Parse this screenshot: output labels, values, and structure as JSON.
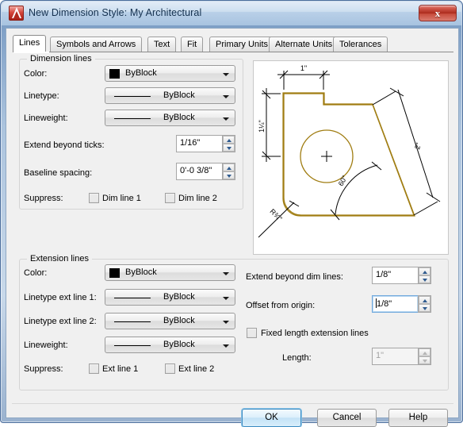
{
  "window": {
    "title": "New Dimension Style: My Architectural",
    "icon": "autocad-logo-icon",
    "close_label": "x"
  },
  "tabs": [
    {
      "label": "Lines",
      "active": true
    },
    {
      "label": "Symbols and Arrows",
      "active": false
    },
    {
      "label": "Text",
      "active": false
    },
    {
      "label": "Fit",
      "active": false
    },
    {
      "label": "Primary Units",
      "active": false
    },
    {
      "label": "Alternate Units",
      "active": false
    },
    {
      "label": "Tolerances",
      "active": false
    }
  ],
  "dimension_lines": {
    "group_title": "Dimension lines",
    "color_label": "Color:",
    "color_value": "ByBlock",
    "color_swatch": "#000000",
    "linetype_label": "Linetype:",
    "linetype_value": "ByBlock",
    "lineweight_label": "Lineweight:",
    "lineweight_value": "ByBlock",
    "extend_beyond_ticks_label": "Extend beyond ticks:",
    "extend_beyond_ticks_value": "1/16\"",
    "baseline_spacing_label": "Baseline spacing:",
    "baseline_spacing_value": "0'-0 3/8\"",
    "suppress_label": "Suppress:",
    "suppress_dim1_label": "Dim line 1",
    "suppress_dim2_label": "Dim line 2"
  },
  "extension_lines": {
    "group_title": "Extension lines",
    "color_label": "Color:",
    "color_value": "ByBlock",
    "color_swatch": "#000000",
    "linetype_ext1_label": "Linetype ext line 1:",
    "linetype_ext1_value": "ByBlock",
    "linetype_ext2_label": "Linetype ext line 2:",
    "linetype_ext2_value": "ByBlock",
    "lineweight_label": "Lineweight:",
    "lineweight_value": "ByBlock",
    "suppress_label": "Suppress:",
    "suppress_ext1_label": "Ext line 1",
    "suppress_ext2_label": "Ext line 2",
    "extend_beyond_dim_label": "Extend beyond dim lines:",
    "extend_beyond_dim_value": "1/8\"",
    "offset_from_origin_label": "Offset from origin:",
    "offset_from_origin_value": "1/8\"",
    "fixed_length_label": "Fixed length extension lines",
    "length_label": "Length:",
    "length_value": "1\""
  },
  "preview": {
    "dim_top": "1\"",
    "dim_left": "1¼\"",
    "dim_radius": "R¾\"",
    "dim_angle": "60°",
    "dim_right": "2\"",
    "geometry_color": "#a07d12",
    "dimension_color": "#000000"
  },
  "footer": {
    "ok_label": "OK",
    "cancel_label": "Cancel",
    "help_label": "Help"
  }
}
